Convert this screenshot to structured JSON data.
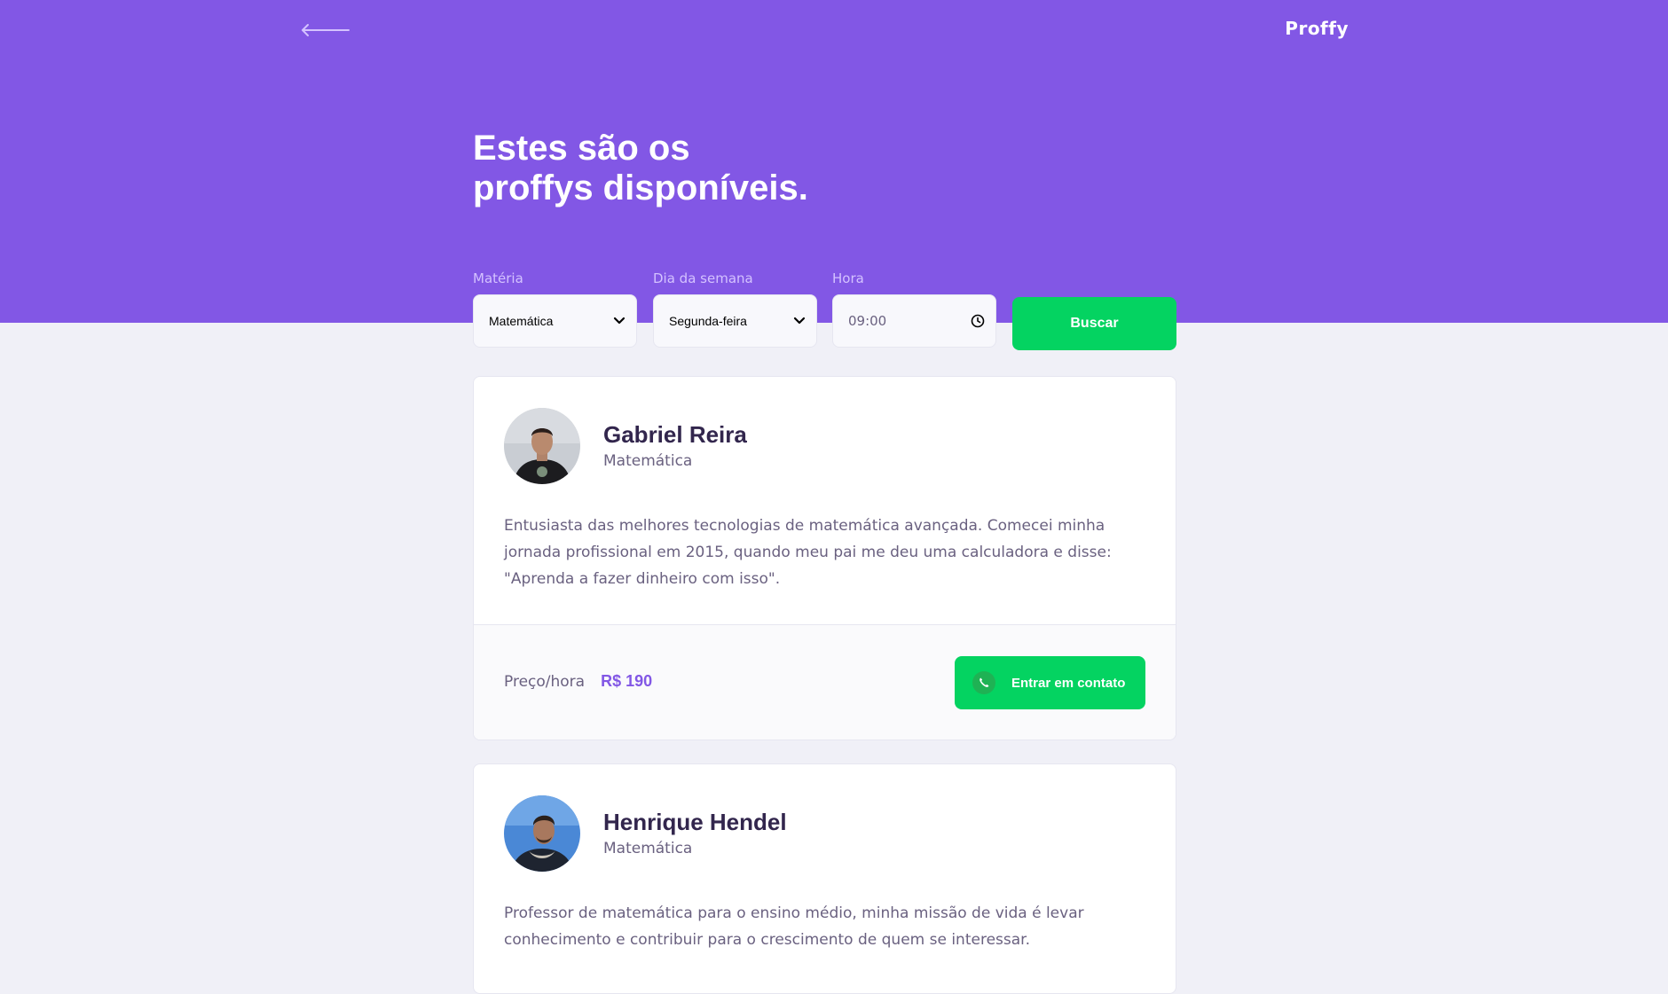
{
  "header": {
    "brand": "Proffy",
    "back_icon": "arrow-left-icon"
  },
  "hero": {
    "title_line1": "Estes são os",
    "title_line2": "proffys disponíveis."
  },
  "filters": {
    "subject": {
      "label": "Matéria",
      "value": "Matemática"
    },
    "weekday": {
      "label": "Dia da semana",
      "value": "Segunda-feira"
    },
    "time": {
      "label": "Hora",
      "value": "09:00"
    },
    "search_label": "Buscar"
  },
  "teachers": [
    {
      "name": "Gabriel Reira",
      "subject": "Matemática",
      "bio": "Entusiasta das melhores tecnologias de matemática avançada. Comecei minha jornada profissional em 2015, quando meu pai me deu uma calculadora e disse: \"Aprenda a fazer dinheiro com isso\".",
      "price_label": "Preço/hora",
      "price": "R$ 190",
      "contact_label": "Entrar em contato"
    },
    {
      "name": "Henrique Hendel",
      "subject": "Matemática",
      "bio": "Professor de matemática para o ensino médio, minha missão de vida é levar conhecimento e contribuir para o crescimento de quem se interessar."
    }
  ],
  "colors": {
    "primary": "#8257E5",
    "secondary": "#04D361",
    "background": "#F0F0F7",
    "title": "#32264D",
    "text": "#6A6180"
  }
}
